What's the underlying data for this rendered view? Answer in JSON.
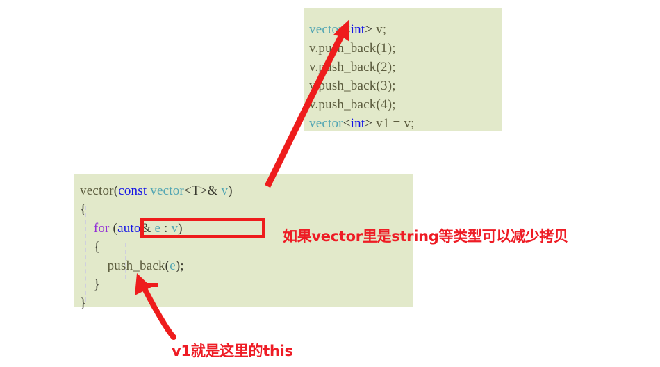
{
  "colors": {
    "code_background": "#e2e9ca",
    "annotation_red": "#ee1c25",
    "highlight_box_red": "#ee1c1c",
    "arrow_red": "#ee1c1c",
    "token_type": "#53a6b3",
    "token_keyword": "#1414e6",
    "token_control": "#9330d6",
    "token_plain": "#5c5c3e",
    "page_background": "#ffffff"
  },
  "code_top": {
    "lines": [
      [
        {
          "t": "vector",
          "c": "type"
        },
        {
          "t": "<",
          "c": "punc"
        },
        {
          "t": "int",
          "c": "kw"
        },
        {
          "t": "> ",
          "c": "punc"
        },
        {
          "t": "v;",
          "c": "plain"
        }
      ],
      [
        {
          "t": "v.push_back(1);",
          "c": "plain"
        }
      ],
      [
        {
          "t": "v.push_back(2);",
          "c": "plain"
        }
      ],
      [
        {
          "t": "v.push_back(3);",
          "c": "plain"
        }
      ],
      [
        {
          "t": "v.push_back(4);",
          "c": "plain"
        }
      ],
      [
        {
          "t": "vector",
          "c": "type"
        },
        {
          "t": "<",
          "c": "punc"
        },
        {
          "t": "int",
          "c": "kw"
        },
        {
          "t": "> ",
          "c": "punc"
        },
        {
          "t": "v1 = v;",
          "c": "plain"
        }
      ]
    ],
    "plain_text": "vector<int> v;\nv.push_back(1);\nv.push_back(2);\nv.push_back(3);\nv.push_back(4);\nvector<int> v1 = v;"
  },
  "code_bottom": {
    "lines": [
      [
        {
          "t": "vector",
          "c": "plain"
        },
        {
          "t": "(",
          "c": "punc"
        },
        {
          "t": "const",
          "c": "kw"
        },
        {
          "t": " ",
          "c": "plain"
        },
        {
          "t": "vector",
          "c": "type"
        },
        {
          "t": "<T>",
          "c": "punc"
        },
        {
          "t": "& ",
          "c": "punc"
        },
        {
          "t": "v",
          "c": "id"
        },
        {
          "t": ")",
          "c": "punc"
        }
      ],
      [
        {
          "t": "{",
          "c": "punc"
        }
      ],
      [
        {
          "t": "    ",
          "c": "plain"
        },
        {
          "t": "for",
          "c": "ctrl"
        },
        {
          "t": " ",
          "c": "plain"
        },
        {
          "t": "(",
          "c": "punc"
        },
        {
          "t": "auto",
          "c": "kw"
        },
        {
          "t": "&",
          "c": "punc"
        },
        {
          "t": " ",
          "c": "plain"
        },
        {
          "t": "e",
          "c": "id"
        },
        {
          "t": " : ",
          "c": "punc"
        },
        {
          "t": "v",
          "c": "id"
        },
        {
          "t": ")",
          "c": "punc"
        }
      ],
      [
        {
          "t": "    {",
          "c": "punc"
        }
      ],
      [
        {
          "t": "        push_back",
          "c": "plain"
        },
        {
          "t": "(",
          "c": "punc"
        },
        {
          "t": "e",
          "c": "id"
        },
        {
          "t": ");",
          "c": "punc"
        }
      ],
      [
        {
          "t": "    }",
          "c": "punc"
        }
      ],
      [
        {
          "t": "}",
          "c": "punc"
        }
      ]
    ],
    "plain_text": "vector(const vector<T>& v)\n{\n    for (auto& e : v)\n    {\n        push_back(e);\n    }\n}"
  },
  "annotations": {
    "right_note": "如果vector里是string等类型可以减少拷贝",
    "bottom_note": "v1就是这里的this"
  },
  "markers": {
    "for_highlight_label": "(auto& e : v)",
    "long_arrow_label": "arrow-from-loop-to-vector-sample",
    "short_arrow_label": "arrow-to-push-back-call"
  }
}
